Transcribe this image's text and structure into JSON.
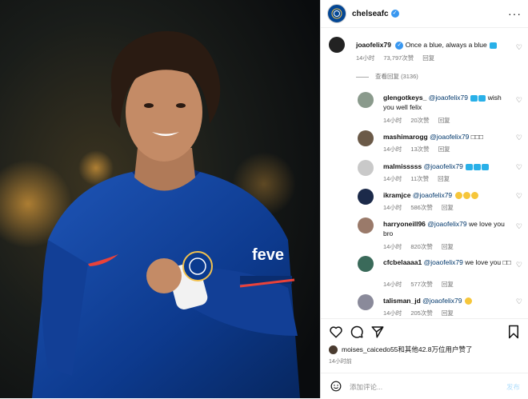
{
  "post_header": {
    "username": "chelseafc",
    "more": "···"
  },
  "caption": {
    "username": "joaofelix79",
    "text": "Once a blue, always a blue",
    "time": "14小时",
    "likes": "73,797次赞",
    "reply": "回复"
  },
  "view_replies": "查看回复 (3136)",
  "comments": [
    {
      "username": "glengotkeys_",
      "mention": "@joaofelix79",
      "text": "wish you well felix",
      "time": "14小时",
      "likes": "20次赞",
      "reply": "回复",
      "avatar_color": "#8a9a8c"
    },
    {
      "username": "mashimarogg",
      "mention": "@joaofelix79",
      "text": "□□□",
      "time": "14小时",
      "likes": "13次赞",
      "reply": "回复",
      "avatar_color": "#6b5a48"
    },
    {
      "username": "malmisssss",
      "mention": "@joaofelix79",
      "text": "",
      "time": "14小时",
      "likes": "11次赞",
      "reply": "回复",
      "avatar_color": "#c9c9c9"
    },
    {
      "username": "ikramjce",
      "mention": "@joaofelix79",
      "text": "",
      "time": "14小时",
      "likes": "586次赞",
      "reply": "回复",
      "avatar_color": "#1c2a4a"
    },
    {
      "username": "harryoneill96",
      "mention": "@joaofelix79",
      "text": "we love you bro",
      "time": "14小时",
      "likes": "820次赞",
      "reply": "回复",
      "avatar_color": "#9a7a6a"
    },
    {
      "username": "cfcbelaaaa1",
      "mention": "@joaofelix79",
      "text": "we love you □□",
      "time": "14小时",
      "likes": "577次赞",
      "reply": "回复",
      "avatar_color": "#3a6a5a"
    },
    {
      "username": "talisman_jd",
      "mention": "@joaofelix79",
      "text": "",
      "time": "14小时",
      "likes": "205次赞",
      "reply": "回复",
      "avatar_color": "#8a8a9a"
    }
  ],
  "liked_by": "moises_caicedo55和其他42.8万位用户赞了",
  "post_time": "14小时前",
  "add_comment": {
    "placeholder": "添加评论...",
    "post_label": "发布"
  },
  "colors": {
    "chelsea_blue": "#034694",
    "link": "#00376b",
    "verified": "#3897f0",
    "post_disabled": "#b2dffc"
  },
  "icons": [
    "heart-icon",
    "comment-icon",
    "share-icon",
    "bookmark-icon",
    "emoji-icon",
    "verified-icon",
    "more-icon"
  ]
}
